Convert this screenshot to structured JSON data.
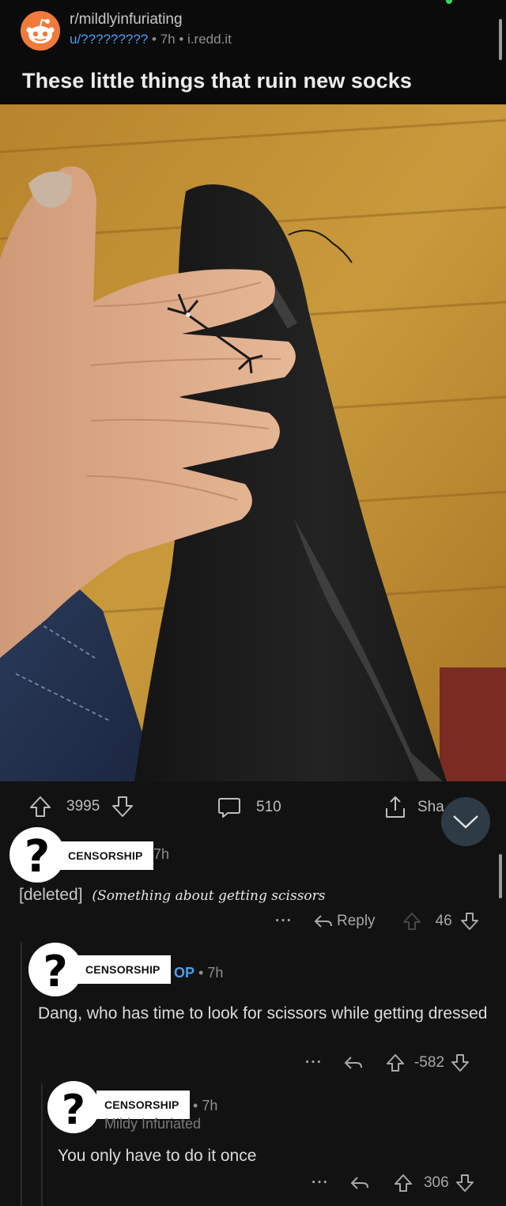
{
  "post": {
    "subreddit": "r/mildlyinfuriating",
    "author": "u/?????????",
    "age": "7h",
    "domain": "i.redd.it",
    "title": "These little things that ruin new socks"
  },
  "actions": {
    "upvotes": "3995",
    "comments": "510",
    "share": "Sha"
  },
  "comments": [
    {
      "censor_label": "CENSORSHIP",
      "age": "7h",
      "body_deleted": "[deleted]",
      "body_note": "(Something about getting scissors",
      "reply_label": "Reply",
      "score": "46",
      "more": "···"
    },
    {
      "censor_label": "CENSORSHIP",
      "op_tag": "OP",
      "age": "7h",
      "body": "Dang, who has time to look for scissors while getting dressed",
      "score": "-582",
      "more": "···"
    },
    {
      "censor_label": "CENSORSHIP",
      "age": "7h",
      "flair": "Mildy Infuriated",
      "body": "You only have to do it once",
      "score": "306",
      "more": "···"
    }
  ],
  "colors": {
    "background": "#121212",
    "header_bg": "#0b0b0b",
    "username_blue": "#4a9ff5",
    "subreddit_orange": "#f07a3a"
  },
  "icons": {
    "subreddit": "reddit-snoo-icon",
    "upvote": "arrow-up-icon",
    "downvote": "arrow-down-icon",
    "comments": "speech-bubble-icon",
    "share": "share-icon",
    "reply": "reply-arrow-icon",
    "collapse": "chevron-down-icon",
    "censor": "question-mark-icon"
  }
}
